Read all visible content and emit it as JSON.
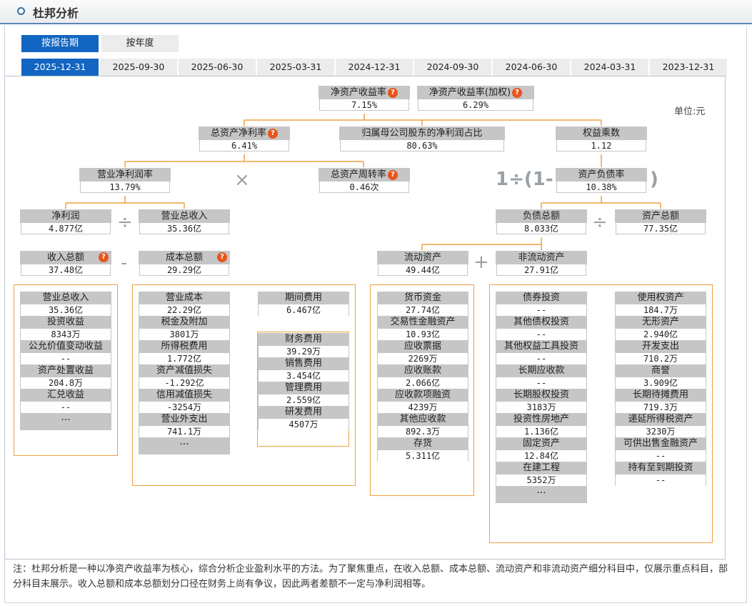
{
  "header": {
    "title": "杜邦分析"
  },
  "mode_tabs": [
    "按报告期",
    "按年度"
  ],
  "date_tabs": [
    "2025-12-31",
    "2025-09-30",
    "2025-06-30",
    "2025-03-31",
    "2024-12-31",
    "2024-09-30",
    "2024-06-30",
    "2024-03-31",
    "2023-12-31"
  ],
  "unit": "单位:元",
  "nodes": {
    "roe": {
      "label": "净资产收益率",
      "value": "7.15%"
    },
    "roe_w": {
      "label": "净资产收益率(加权)",
      "value": "6.29%"
    },
    "roa": {
      "label": "总资产净利率",
      "value": "6.41%"
    },
    "parent_ratio": {
      "label": "归属母公司股东的净利润占比",
      "value": "80.63%"
    },
    "equity_mult": {
      "label": "权益乘数",
      "value": "1.12"
    },
    "net_margin": {
      "label": "营业净利润率",
      "value": "13.79%"
    },
    "turnover": {
      "label": "总资产周转率",
      "value": "0.46次"
    },
    "debt_ratio": {
      "label": "资产负债率",
      "value": "10.38%"
    },
    "net_profit": {
      "label": "净利润",
      "value": "4.877亿"
    },
    "revenue": {
      "label": "营业总收入",
      "value": "35.36亿"
    },
    "liab": {
      "label": "负债总额",
      "value": "8.033亿"
    },
    "assets": {
      "label": "资产总额",
      "value": "77.35亿"
    },
    "income_total": {
      "label": "收入总额",
      "value": "37.48亿"
    },
    "cost_total": {
      "label": "成本总额",
      "value": "29.29亿"
    },
    "current_assets": {
      "label": "流动资产",
      "value": "49.44亿"
    },
    "noncurrent_assets": {
      "label": "非流动资产",
      "value": "27.91亿"
    }
  },
  "ops": {
    "times": "×",
    "divide": "÷",
    "minus": "-",
    "plus": "+",
    "one_div": "1÷(1-",
    "close": ")",
    "more": "···",
    "q": "?"
  },
  "income_items": [
    {
      "label": "营业总收入",
      "value": "35.36亿"
    },
    {
      "label": "投资收益",
      "value": "8343万"
    },
    {
      "label": "公允价值变动收益",
      "value": "--"
    },
    {
      "label": "资产处置收益",
      "value": "204.8万"
    },
    {
      "label": "汇兑收益",
      "value": "--"
    }
  ],
  "cost_items": [
    {
      "label": "营业成本",
      "value": "22.29亿"
    },
    {
      "label": "税金及附加",
      "value": "3801万"
    },
    {
      "label": "所得税费用",
      "value": "1.772亿"
    },
    {
      "label": "资产减值损失",
      "value": "-1.292亿"
    },
    {
      "label": "信用减值损失",
      "value": "-3254万"
    },
    {
      "label": "营业外支出",
      "value": "741.1万"
    }
  ],
  "period_expense": {
    "label": "期间费用",
    "value": "6.467亿"
  },
  "period_items": [
    {
      "label": "财务费用",
      "value": "39.29万"
    },
    {
      "label": "销售费用",
      "value": "3.454亿"
    },
    {
      "label": "管理费用",
      "value": "2.559亿"
    },
    {
      "label": "研发费用",
      "value": "4507万"
    }
  ],
  "current_items": [
    {
      "label": "货币资金",
      "value": "27.74亿"
    },
    {
      "label": "交易性金融资产",
      "value": "10.93亿"
    },
    {
      "label": "应收票据",
      "value": "2269万"
    },
    {
      "label": "应收账款",
      "value": "2.066亿"
    },
    {
      "label": "应收款项融资",
      "value": "4239万"
    },
    {
      "label": "其他应收款",
      "value": "892.3万"
    },
    {
      "label": "存货",
      "value": "5.311亿"
    }
  ],
  "noncurrent_left": [
    {
      "label": "债券投资",
      "value": "--"
    },
    {
      "label": "其他债权投资",
      "value": "--"
    },
    {
      "label": "其他权益工具投资",
      "value": "--"
    },
    {
      "label": "长期应收款",
      "value": "--"
    },
    {
      "label": "长期股权投资",
      "value": "3183万"
    },
    {
      "label": "投资性房地产",
      "value": "1.136亿"
    },
    {
      "label": "固定资产",
      "value": "12.84亿"
    },
    {
      "label": "在建工程",
      "value": "5352万"
    }
  ],
  "noncurrent_right": [
    {
      "label": "使用权资产",
      "value": "184.7万"
    },
    {
      "label": "无形资产",
      "value": "2.940亿"
    },
    {
      "label": "开发支出",
      "value": "710.2万"
    },
    {
      "label": "商誉",
      "value": "3.909亿"
    },
    {
      "label": "长期待摊费用",
      "value": "719.3万"
    },
    {
      "label": "递延所得税资产",
      "value": "3230万"
    },
    {
      "label": "可供出售金融资产",
      "value": "--"
    },
    {
      "label": "持有至到期投资",
      "value": "--"
    }
  ],
  "note": "注：杜邦分析是一种以净资产收益率为核心，综合分析企业盈利水平的方法。为了聚焦重点，在收入总额、成本总额、流动资产和非流动资产细分科目中，仅展示重点科目，部分科目未展示。收入总额和成本总额划分口径在财务上尚有争议，因此两者差额不一定与净利润相等。"
}
